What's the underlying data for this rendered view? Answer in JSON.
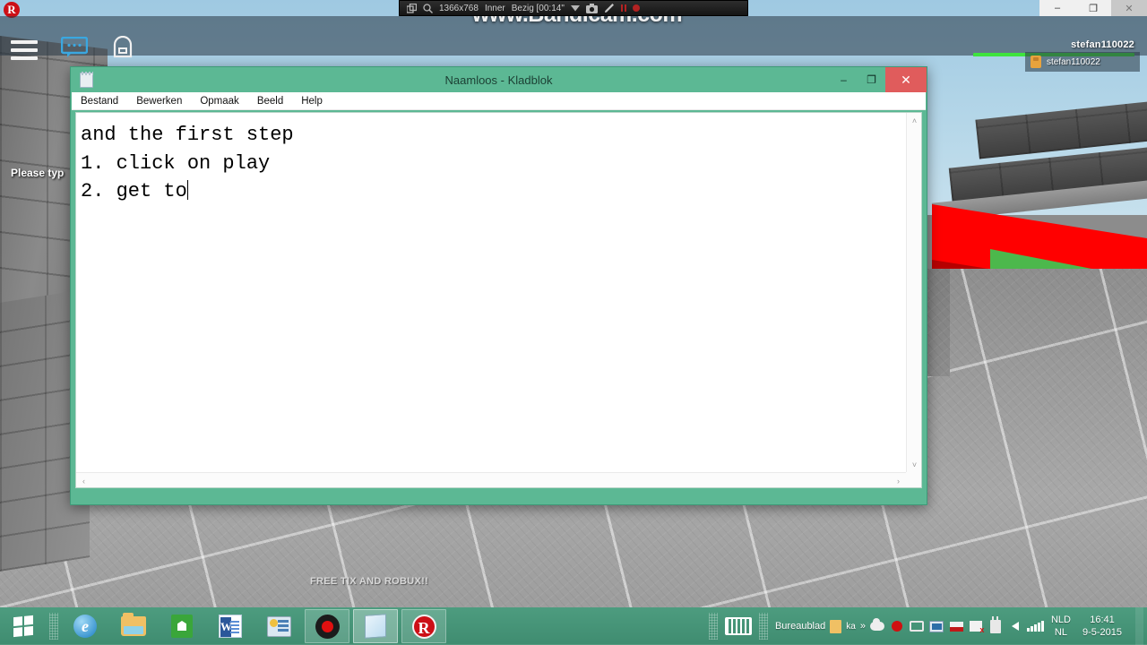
{
  "game": {
    "hud": {
      "logo": "roblox-logo",
      "menu_icon": "hamburger-menu-icon",
      "chat_icon": "chat-bubble-icon",
      "backpack_icon": "backpack-icon",
      "username": "stefan110022",
      "health_percent": 100,
      "player_list": [
        {
          "name": "stefan110022"
        }
      ]
    },
    "overlay_text": {
      "please_type": "Please typ",
      "free_tix": "FREE TIX AND ROBUX!!"
    },
    "colors": {
      "sky": "#b4d6e8",
      "platform_red": "#ff0000",
      "platform_green": "#4cb84c",
      "stone_gray": "#9a9a9a"
    }
  },
  "bandicam": {
    "resolution": "1366x768",
    "mode": "Inner",
    "status": "Bezig [00:14\"",
    "watermark": "www.Bandicam.com",
    "icons": [
      "window-target-icon",
      "magnifier-icon",
      "dropdown-caret-icon",
      "camera-icon",
      "pencil-icon",
      "pause-icon",
      "record-icon"
    ]
  },
  "top_right_window_controls": {
    "minimize": "–",
    "restore": "❐",
    "close": "✕"
  },
  "notepad": {
    "title": "Naamloos - Kladblok",
    "icon": "notepad-icon",
    "menu": [
      "Bestand",
      "Bewerken",
      "Opmaak",
      "Beeld",
      "Help"
    ],
    "window_buttons": {
      "minimize": "–",
      "maximize": "❐",
      "close": "✕"
    },
    "content": "and the first step\n1. click on play\n2. get to",
    "scroll": {
      "up": "˄",
      "down": "˅",
      "left": "‹",
      "right": "›"
    },
    "frame_color": "#5cb894"
  },
  "taskbar": {
    "start": "start-button",
    "items": [
      {
        "name": "internet-explorer",
        "state": "normal"
      },
      {
        "name": "file-explorer",
        "state": "normal"
      },
      {
        "name": "windows-store",
        "state": "normal"
      },
      {
        "name": "microsoft-word",
        "state": "normal"
      },
      {
        "name": "control-panel",
        "state": "normal"
      },
      {
        "name": "bandicam",
        "state": "open"
      },
      {
        "name": "notepad",
        "state": "active"
      },
      {
        "name": "roblox",
        "state": "open"
      }
    ],
    "tray": {
      "toolbar_label": "Bureaublad",
      "overflow": "»",
      "word_label": "ka",
      "keyboard_icon": "touch-keyboard-icon",
      "icons": [
        "onedrive-icon",
        "bandicam-recording-icon",
        "display-icon",
        "remote-desktop-icon",
        "dropbox-icon",
        "network-error-icon",
        "usb-eject-icon",
        "volume-icon",
        "signal-bars-icon"
      ],
      "language_top": "NLD",
      "language_bottom": "NL",
      "time": "16:41",
      "date": "9-5-2015"
    }
  }
}
